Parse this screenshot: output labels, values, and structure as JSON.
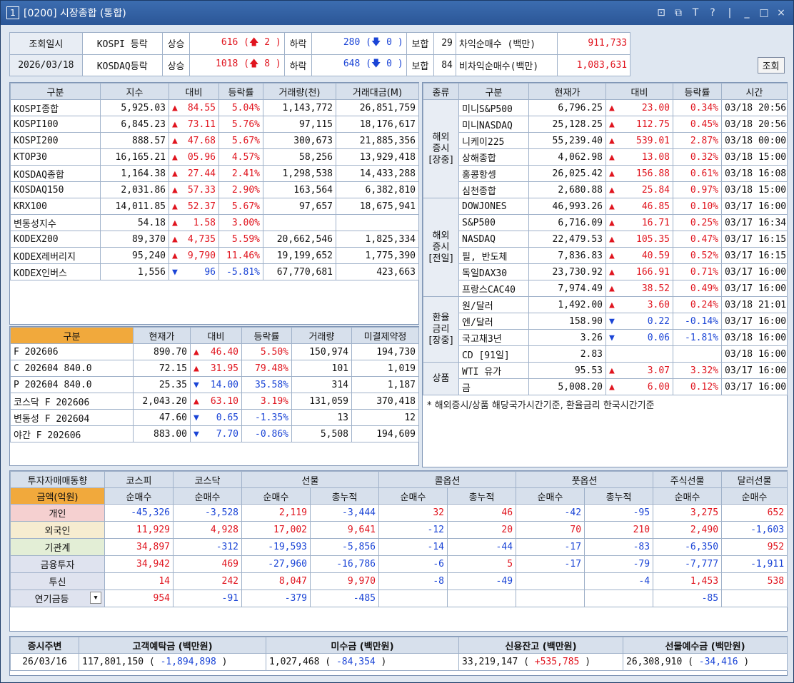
{
  "window": {
    "id": "1",
    "title": "[0200] 시장종합 (통합)"
  },
  "header": {
    "query_label": "조회일시",
    "date": "2026/03/18",
    "kospi_label": "KOSPI 등락",
    "kosdaq_label": "KOSDAQ등락",
    "up": "상승",
    "down": "하락",
    "flat": "보합",
    "kospi_up": "616 (🡅 2 )",
    "kospi_down": "280 (🡇 0 )",
    "kospi_flat": "29",
    "kosdaq_up": "1018 (🡅 8 )",
    "kosdaq_down": "648 (🡇 0 )",
    "kosdaq_flat": "84",
    "arb_label": "차익순매수 (백만)",
    "arb_value": "911,733",
    "nonarb_label": "비차익순매수(백만)",
    "nonarb_value": "1,083,631",
    "search_button": "조회"
  },
  "indices": {
    "cols": [
      "구분",
      "지수",
      "대비",
      "등락률",
      "거래량(천)",
      "거래대금(M)"
    ],
    "rows": [
      [
        "KOSPI종합",
        "5,925.03",
        "84.55",
        "5.04%",
        "1,143,772",
        "26,851,759",
        "up"
      ],
      [
        "KOSPI100",
        "6,845.23",
        "73.11",
        "5.76%",
        "97,115",
        "18,176,617",
        "up"
      ],
      [
        "KOSPI200",
        "888.57",
        "47.68",
        "5.67%",
        "300,673",
        "21,885,356",
        "up"
      ],
      [
        "KTOP30",
        "16,165.21",
        "05.96",
        "4.57%",
        "58,256",
        "13,929,418",
        "up"
      ],
      [
        "KOSDAQ종합",
        "1,164.38",
        "27.44",
        "2.41%",
        "1,298,538",
        "14,433,288",
        "up"
      ],
      [
        "KOSDAQ150",
        "2,031.86",
        "57.33",
        "2.90%",
        "163,564",
        "6,382,810",
        "up"
      ],
      [
        "KRX100",
        "14,011.85",
        "52.37",
        "5.67%",
        "97,657",
        "18,675,941",
        "up"
      ],
      [
        "변동성지수",
        "54.18",
        "1.58",
        "3.00%",
        "",
        "",
        "up"
      ],
      [
        "KODEX200",
        "89,370",
        "4,735",
        "5.59%",
        "20,662,546",
        "1,825,334",
        "up"
      ],
      [
        "KODEX레버리지",
        "95,240",
        "9,790",
        "11.46%",
        "19,199,652",
        "1,775,390",
        "up"
      ],
      [
        "KODEX인버스",
        "1,556",
        "96",
        "-5.81%",
        "67,770,681",
        "423,663",
        "down"
      ]
    ]
  },
  "futures": {
    "cols": [
      "구분",
      "현재가",
      "대비",
      "등락률",
      "거래량",
      "미결제약정"
    ],
    "rows": [
      [
        "F 202606",
        "890.70",
        "46.40",
        "5.50%",
        "150,974",
        "194,730",
        "up"
      ],
      [
        "C 202604    840.0",
        "72.15",
        "31.95",
        "79.48%",
        "101",
        "1,019",
        "up"
      ],
      [
        "P 202604    840.0",
        "25.35",
        "14.00",
        "35.58%",
        "314",
        "1,187",
        "down"
      ],
      [
        "코스닥 F 202606",
        "2,043.20",
        "63.10",
        "3.19%",
        "131,059",
        "370,418",
        "up"
      ],
      [
        "변동성 F 202604",
        "47.60",
        "0.65",
        "-1.35%",
        "13",
        "12",
        "down"
      ],
      [
        "야간 F 202606",
        "883.00",
        "7.70",
        "-0.86%",
        "5,508",
        "194,609",
        "down"
      ]
    ]
  },
  "global": {
    "cols": [
      "종류",
      "구분",
      "현재가",
      "대비",
      "등락률",
      "시간"
    ],
    "groups": [
      {
        "name": "해외\n증시\n[장중]",
        "rows": [
          [
            "미니S&P500",
            "6,796.25",
            "23.00",
            "0.34%",
            "03/18 20:56",
            "up"
          ],
          [
            "미니NASDAQ",
            "25,128.25",
            "112.75",
            "0.45%",
            "03/18 20:56",
            "up"
          ],
          [
            "니케이225",
            "55,239.40",
            "539.01",
            "2.87%",
            "03/18 00:00",
            "up"
          ],
          [
            "상해종합",
            "4,062.98",
            "13.08",
            "0.32%",
            "03/18 15:00",
            "up"
          ],
          [
            "홍콩항셍",
            "26,025.42",
            "156.88",
            "0.61%",
            "03/18 16:08",
            "up"
          ],
          [
            "심천종합",
            "2,680.88",
            "25.84",
            "0.97%",
            "03/18 15:00",
            "up"
          ]
        ]
      },
      {
        "name": "해외\n증시\n[전일]",
        "rows": [
          [
            "DOWJONES",
            "46,993.26",
            "46.85",
            "0.10%",
            "03/17 16:00",
            "up"
          ],
          [
            "S&P500",
            "6,716.09",
            "16.71",
            "0.25%",
            "03/17 16:34",
            "up"
          ],
          [
            "NASDAQ",
            "22,479.53",
            "105.35",
            "0.47%",
            "03/17 16:15",
            "up"
          ],
          [
            "필, 반도체",
            "7,836.83",
            "40.59",
            "0.52%",
            "03/17 16:15",
            "up"
          ],
          [
            "독일DAX30",
            "23,730.92",
            "166.91",
            "0.71%",
            "03/17 16:00",
            "up"
          ],
          [
            "프랑스CAC40",
            "7,974.49",
            "38.52",
            "0.49%",
            "03/17 16:00",
            "up"
          ]
        ]
      },
      {
        "name": "환율\n금리\n[장중]",
        "rows": [
          [
            "원/달러",
            "1,492.00",
            "3.60",
            "0.24%",
            "03/18 21:01",
            "up"
          ],
          [
            "엔/달러",
            "158.90",
            "0.22",
            "-0.14%",
            "03/17 16:00",
            "down"
          ],
          [
            "국고채3년",
            "3.26",
            "0.06",
            "-1.81%",
            "03/18 16:00",
            "down"
          ],
          [
            "CD [91일]",
            "2.83",
            "",
            "",
            "03/18 16:00",
            ""
          ]
        ]
      },
      {
        "name": "상품",
        "rows": [
          [
            "WTI 유가",
            "95.53",
            "3.07",
            "3.32%",
            "03/17 16:00",
            "up"
          ],
          [
            "금",
            "5,008.20",
            "6.00",
            "0.12%",
            "03/17 16:00",
            "up"
          ]
        ]
      }
    ],
    "note": "* 해외증시/상품 해당국가시간기준, 환율금리 한국시간기준"
  },
  "investor": {
    "title": "투자자매매동향",
    "unit": "금액(억원)",
    "groups": [
      "코스피",
      "코스닥",
      "선물",
      "콜옵션",
      "풋옵션",
      "주식선물",
      "달러선물"
    ],
    "subcols": [
      "순매수",
      "순매수",
      "순매수",
      "총누적",
      "순매수",
      "총누적",
      "순매수",
      "총누적",
      "순매수",
      "순매수"
    ],
    "rows": [
      [
        "개인",
        "-45,326",
        "-3,528",
        "2,119",
        "-3,444",
        "32",
        "46",
        "-42",
        "-95",
        "3,275",
        "652"
      ],
      [
        "외국인",
        "11,929",
        "4,928",
        "17,002",
        "9,641",
        "-12",
        "20",
        "70",
        "210",
        "2,490",
        "-1,603"
      ],
      [
        "기관계",
        "34,897",
        "-312",
        "-19,593",
        "-5,856",
        "-14",
        "-44",
        "-17",
        "-83",
        "-6,350",
        "952"
      ],
      [
        "금융투자",
        "34,942",
        "469",
        "-27,960",
        "-16,786",
        "-6",
        "5",
        "-17",
        "-79",
        "-7,777",
        "-1,911"
      ],
      [
        "투신",
        "14",
        "242",
        "8,047",
        "9,970",
        "-8",
        "-49",
        "",
        "-4",
        "1,453",
        "538"
      ],
      [
        "연기금등",
        "954",
        "-91",
        "-379",
        "-485",
        "",
        "",
        "",
        "",
        "-85",
        ""
      ]
    ]
  },
  "footer": {
    "cols": [
      "증시주변",
      "고객예탁금 (백만원)",
      "미수금 (백만원)",
      "신용잔고 (백만원)",
      "선물예수금 (백만원)"
    ],
    "date": "26/03/16",
    "deposit": "117,801,150",
    "deposit_chg": "-1,894,898",
    "unpaid": "1,027,468",
    "unpaid_chg": "-84,354",
    "credit": "33,219,147",
    "credit_chg": "+535,785",
    "futdep": "26,308,910",
    "futdep_chg": "-34,416"
  }
}
